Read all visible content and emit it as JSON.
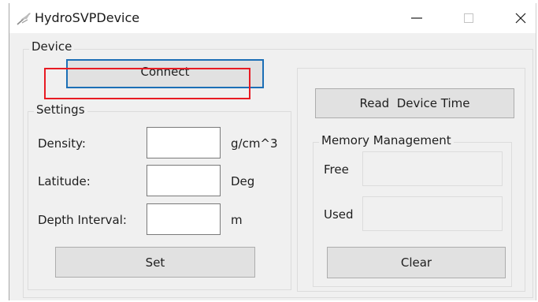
{
  "window": {
    "title": "HydroSVPDevice",
    "icons": {
      "app": "feather-icon",
      "minimize": "minimize-icon",
      "maximize": "maximize-icon",
      "close": "close-icon"
    }
  },
  "device": {
    "group_title": "Device",
    "connect_label": "Connect"
  },
  "settings": {
    "group_title": "Settings",
    "fields": [
      {
        "label": "Density:",
        "value": "",
        "unit": "g/cm^3"
      },
      {
        "label": "Latitude:",
        "value": "",
        "unit": "Deg"
      },
      {
        "label": "Depth Interval:",
        "value": "",
        "unit": "m"
      }
    ],
    "set_label": "Set"
  },
  "device_time": {
    "read_label": "Read  Device Time"
  },
  "memory": {
    "group_title": "Memory Management",
    "free_label": "Free",
    "free_value": "",
    "used_label": "Used",
    "used_value": "",
    "clear_label": "Clear"
  },
  "colors": {
    "focus_border": "#1c6fb6",
    "annotation_box": "#e81b23",
    "button_face": "#e1e1e1",
    "window_bg": "#f0f0f0"
  }
}
